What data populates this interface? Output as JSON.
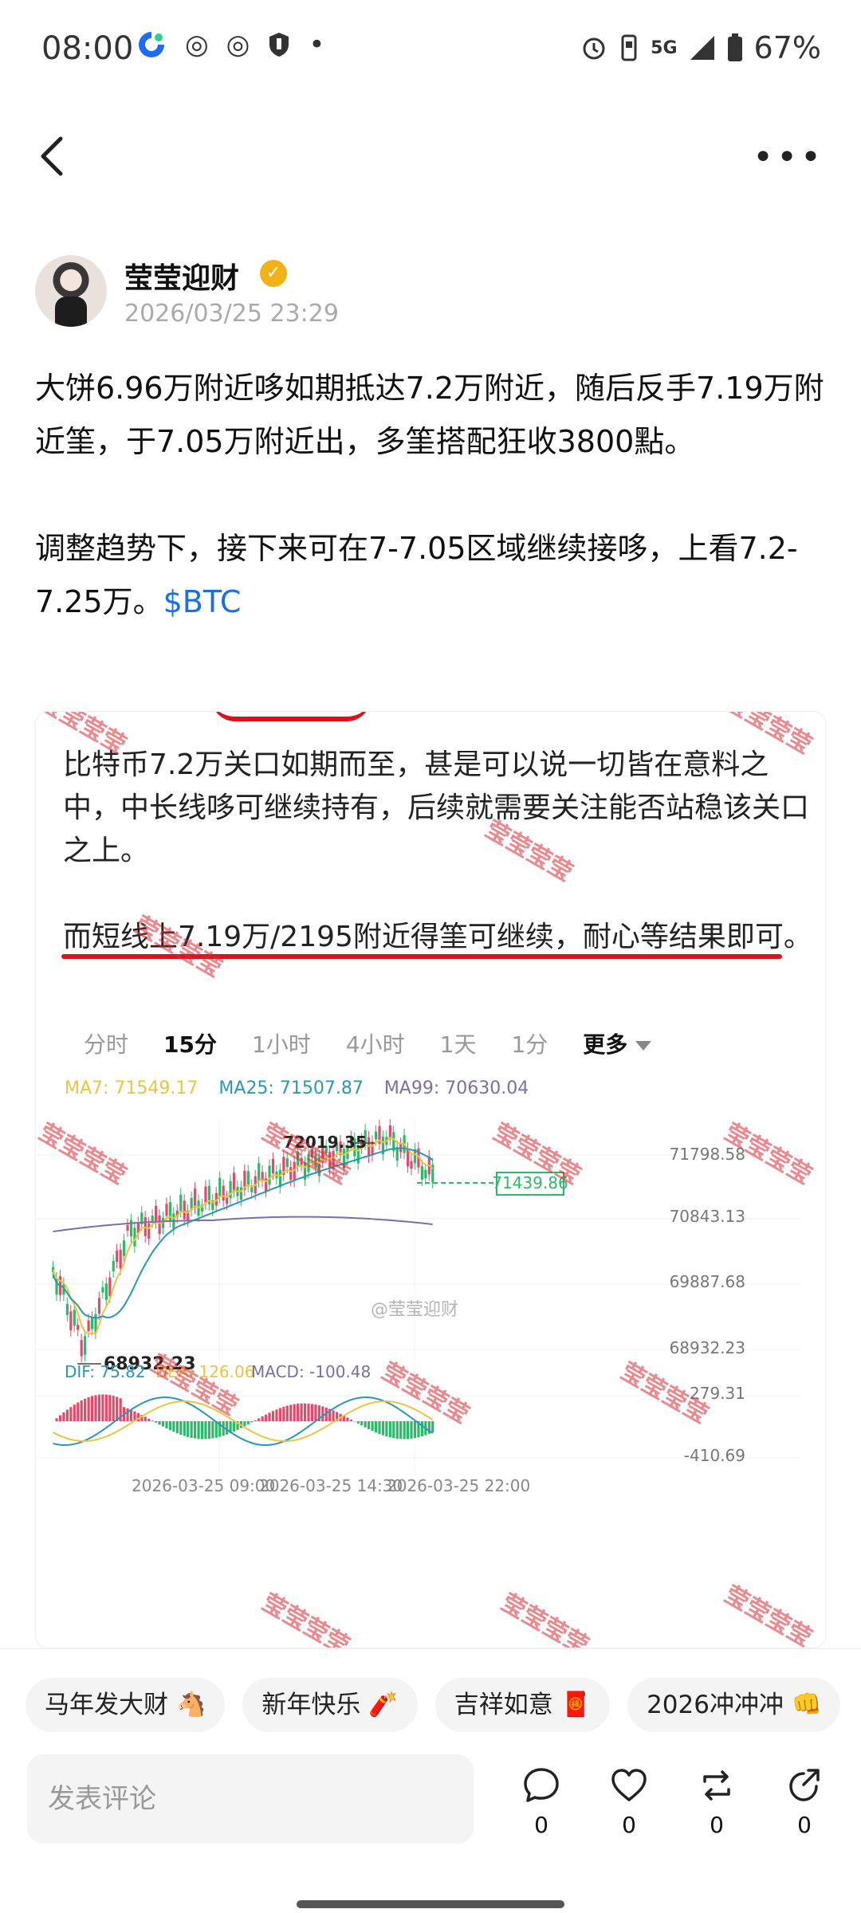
{
  "status_bar": {
    "time": "08:00",
    "battery": "67%",
    "network": "5G",
    "icons": [
      "app-logo-icon",
      "weibo-icon",
      "weibo-icon",
      "shield-icon",
      "dot-icon",
      "alarm-icon",
      "vibrate-icon",
      "signal-icon",
      "battery-icon"
    ]
  },
  "nav": {
    "back_icon": "chevron-left-icon",
    "more_icon": "more-dots-icon"
  },
  "author": {
    "name": "莹莹迎财",
    "verified_icon": "verified-badge-icon",
    "timestamp": "2026/03/25 23:29"
  },
  "post": {
    "para1": "大饼6.96万附近哆如期抵达7.2万附近，随后反手7.19万附近筀，于7.05万附近出，多筀搭配狂收3800點。",
    "para2_text": "调整趋势下，接下来可在7-7.05区域继续接哆，上看7.2-7.25万。",
    "para2_tag": "$BTC"
  },
  "embed": {
    "para1": "比特币7.2万关口如期而至，甚是可以说一切皆在意料之中，中长线哆可继续持有，后续就需要关注能否站稳该关口之上。",
    "para2": "而短线上7.19万/2195附近得筀可继续，耐心等结果即可。",
    "timeframes": [
      "分时",
      "15分",
      "1小时",
      "4小时",
      "1天",
      "1分"
    ],
    "active_timeframe": "15分",
    "more_label": "更多",
    "ma": {
      "ma7": "MA7: 71549.17",
      "ma25": "MA25: 71507.87",
      "ma99": "MA99: 70630.04"
    },
    "macd": {
      "dif": "DIF: 75.82",
      "dea": "DEA: 126.06",
      "macd": "MACD: -100.48"
    },
    "watermark": "莹莹莹莹",
    "center_watermark": "@莹莹迎财",
    "colors": {
      "up": "#2eb86a",
      "down": "#e24a6b",
      "ma7": "#e9c542",
      "ma25": "#2a97b8",
      "ma99": "#7c6ea6",
      "annotation": "#d9121b"
    }
  },
  "chart_data": {
    "type": "candlestick",
    "price_ticks": [
      "71798.58",
      "70843.13",
      "69887.68",
      "68932.23"
    ],
    "current_price": "71439.86",
    "high_label": "72019.35",
    "low_label": "68932.23",
    "macd_ticks": [
      "279.31",
      "-410.69"
    ],
    "time_labels": [
      "2026-03-25 09:00",
      "2026-03-25 14:30",
      "2026-03-25 22:00"
    ],
    "ylim": [
      68932.23,
      72019.35
    ]
  },
  "chips": [
    {
      "label": "马年发大财",
      "emoji": "🐴"
    },
    {
      "label": "新年快乐",
      "emoji": "🧨"
    },
    {
      "label": "吉祥如意",
      "emoji": "🧧"
    },
    {
      "label": "2026冲冲冲",
      "emoji": "👊"
    }
  ],
  "comment_placeholder": "发表评论",
  "actions": [
    {
      "name": "comment",
      "icon": "comment-bubble-icon",
      "count": "0"
    },
    {
      "name": "like",
      "icon": "heart-icon",
      "count": "0"
    },
    {
      "name": "repost",
      "icon": "repost-icon",
      "count": "0"
    },
    {
      "name": "share",
      "icon": "share-arrow-icon",
      "count": "0"
    }
  ]
}
